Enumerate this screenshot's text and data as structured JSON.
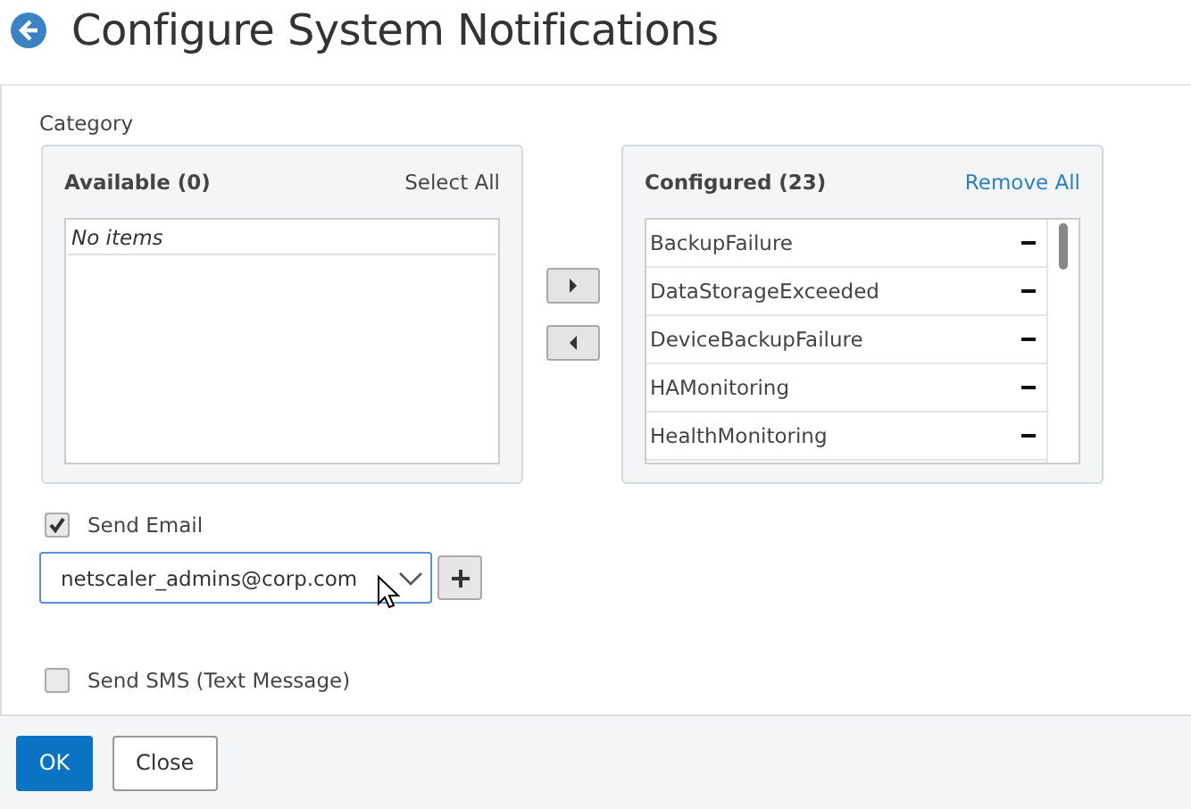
{
  "title": "Configure System Notifications",
  "category_label": "Category",
  "available": {
    "title": "Available (0)",
    "action": "Select All",
    "empty_text": "No items"
  },
  "configured": {
    "title": "Configured (23)",
    "action": "Remove All",
    "items": [
      {
        "label": "BackupFailure"
      },
      {
        "label": "DataStorageExceeded"
      },
      {
        "label": "DeviceBackupFailure"
      },
      {
        "label": "HAMonitoring"
      },
      {
        "label": "HealthMonitoring"
      }
    ]
  },
  "send_email": {
    "label": "Send Email",
    "checked": true,
    "value": "netscaler_admins@corp.com"
  },
  "send_sms": {
    "label": "Send SMS (Text Message)",
    "checked": false
  },
  "buttons": [
    {
      "label": "OK",
      "kind": "primary"
    },
    {
      "label": "Close",
      "kind": "secondary"
    }
  ]
}
